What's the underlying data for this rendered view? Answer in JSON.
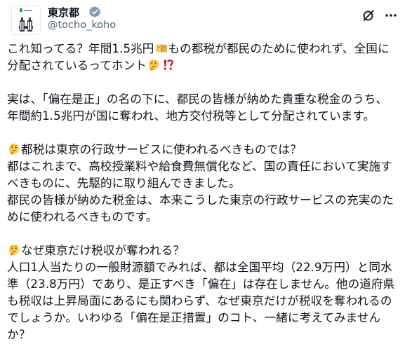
{
  "author": {
    "display_name": "東京都",
    "handle": "@tocho_koho",
    "avatar_icon": "tokyo-metropolitan-government-logo",
    "verified_icon": "government-verified-badge-icon",
    "verified_color": "#829aab"
  },
  "actions": {
    "grok_icon": "grok-icon",
    "more_icon": "more-options-icon"
  },
  "text": {
    "p1_l1_a": "これ知ってる？年間1.5兆円",
    "p1_l1_b": "もの都税が都民のために使われず、全国に",
    "p1_l2": "分配されているってホント",
    "p2_l1": "実は、「偏在是正」の名の下に、都民の皆様が納めた貴重な税金のうち、",
    "p2_l2": "年間約1.5兆円が国に奪われ、地方交付税等として分配されています。",
    "p3_l1": "都税は東京の行政サービスに使われるべきものでは？",
    "p3_l2": "都はこれまで、高校授業料や給食費無償化など、国の責任において実施す",
    "p3_l3": "べきものに、先駆的に取り組んできました。",
    "p3_l4": "都民の皆様が納めた税金は、本来こうした東京の行政サービスの充実のた",
    "p3_l5": "めに使われるべきものです。",
    "p4_l1": "なぜ東京だけ税収が奪われる？",
    "p4_l2": "人口1人当たりの一般財源額でみれば、都は全国平均（22.9万円）と同水",
    "p4_l3": "準（23.8万円）であり、是正すべき「偏在」は存在しません。他の道府県",
    "p4_l4": "も税収は上昇局面にあるにも関わらず、なぜ東京だけが税収を奪われるの",
    "p4_l5": "でしょうか。いわゆる「偏在是正措置」のコト、一緒に考えてみません",
    "p4_l6": "か？"
  },
  "emojis": [
    "money-bag-icon",
    "thinking-face-icon",
    "exclamation-question-icon"
  ]
}
